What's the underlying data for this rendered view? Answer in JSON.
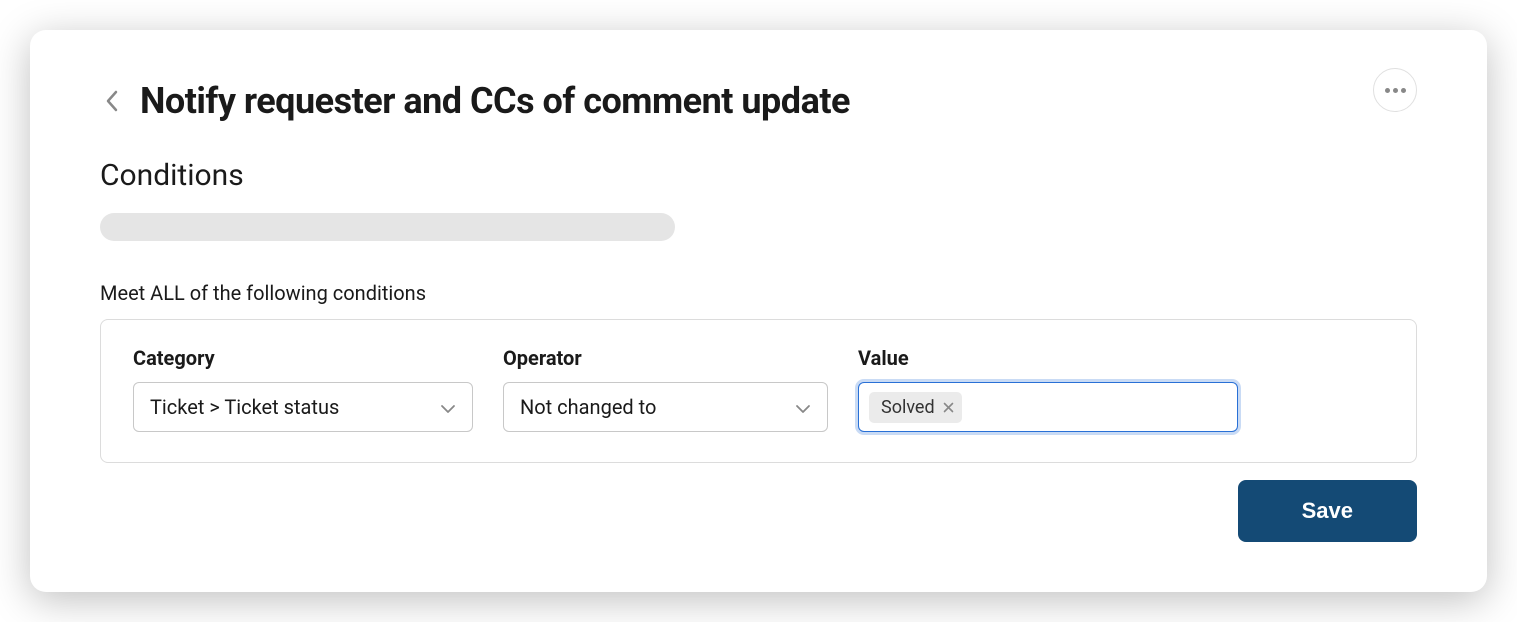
{
  "header": {
    "title": "Notify requester and CCs of comment update"
  },
  "section": {
    "heading": "Conditions",
    "meet_all_label": "Meet ALL of the following conditions"
  },
  "condition": {
    "category": {
      "label": "Category",
      "value": "Ticket > Ticket status"
    },
    "operator": {
      "label": "Operator",
      "value": "Not changed to"
    },
    "value": {
      "label": "Value",
      "tags": [
        {
          "text": "Solved"
        }
      ]
    }
  },
  "footer": {
    "save_label": "Save"
  }
}
